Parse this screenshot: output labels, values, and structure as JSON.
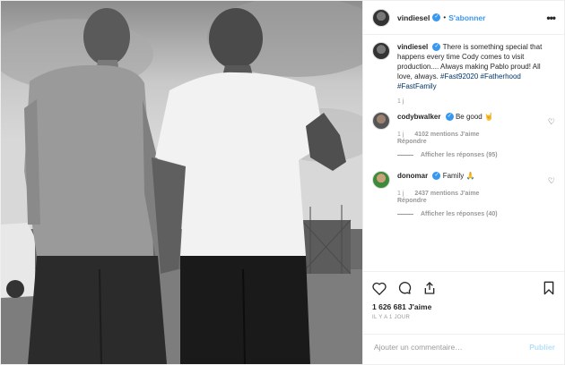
{
  "post": {
    "username": "vindiesel",
    "follow_label": "S'abonner",
    "dot": "•",
    "more_label": "•••",
    "caption": {
      "username": "vindiesel",
      "text": "There is something special that happens every time Cody comes to visit production.... Always making Pablo proud! All love, always.",
      "hashtags": "#Fast92020 #Fatherhood #FastFamily",
      "time": "1 j"
    },
    "comments": [
      {
        "username": "codybwalker",
        "text": "Be good",
        "emoji": "🤘",
        "time": "1 j",
        "likes": "4102 mentions J'aime",
        "reply": "Répondre",
        "view_replies": "Afficher les réponses (95)"
      },
      {
        "username": "donomar",
        "text": "Family",
        "emoji": "🙏",
        "time": "1 j",
        "likes": "2437 mentions J'aime",
        "reply": "Répondre",
        "view_replies": "Afficher les réponses (40)"
      }
    ],
    "likes_count": "1 626 681 J'aime",
    "time_ago": "IL Y A 1 JOUR",
    "comment_placeholder": "Ajouter un commentaire…",
    "publish_label": "Publier"
  },
  "icons": [
    "heart-icon",
    "comment-icon",
    "share-icon",
    "save-icon",
    "verified-icon",
    "more-icon"
  ]
}
